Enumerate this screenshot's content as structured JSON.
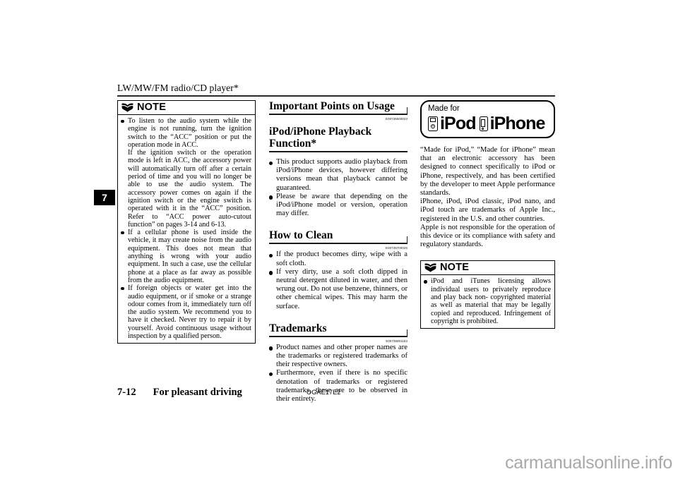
{
  "page": {
    "running_header": "LW/MW/FM radio/CD player*",
    "chapter_tab": "7",
    "folio": "7-12",
    "footer_title": "For pleasant driving",
    "doc_code": "OGAE17E2",
    "watermark": "carmanualsonline.info"
  },
  "left_column": {
    "note_box": {
      "title": "NOTE",
      "icon": "open-book-icon",
      "items": [
        "To listen to the audio system while the engine is not running, turn the ignition switch to the “ACC” position or put the operation mode in ACC.",
        "If a cellular phone is used inside the vehicle, it may create noise from the audio equipment. This does not mean that anything is wrong with your audio equipment. In such a case, use the cellular phone at a place as far away as possible from the audio equipment.",
        "If foreign objects or water get into the audio equipment, or if smoke or a strange odour comes from it, immediately turn off the audio system. We recommend you to have it checked. Never try to repair it by yourself. Avoid continuous usage without inspection by a qualified person."
      ],
      "continuation": "If the ignition switch or the operation mode is left in ACC, the accessory power will automatically turn off after a certain period of time and you will no longer be able to use the audio system. The accessory power comes on again if the ignition switch or the engine switch is operated with it in the “ACC” position. Refer to “ACC power auto-cutout function” on pages 3-14 and 6-13."
    }
  },
  "middle_column": {
    "sections": [
      {
        "title": "Important Points on Usage",
        "ref_code": "E00735500023",
        "items": []
      },
      {
        "title": "iPod/iPhone Playback Function*",
        "ref_code": "",
        "items": [
          "This product supports audio playback from iPod/iPhone devices, however differing versions mean that playback cannot be guaranteed.",
          "Please be aware that depending on the iPod/iPhone model or version, operation may differ."
        ]
      },
      {
        "title": "How to Clean",
        "ref_code": "E00735700025",
        "items": [
          "If the product becomes dirty, wipe with a soft cloth.",
          "If very dirty, use a soft cloth dipped in neutral detergent diluted in water, and then wrung out. Do not use benzene, thinners, or other chemical wipes. This may harm the surface."
        ]
      },
      {
        "title": "Trademarks",
        "ref_code": "E00735801153",
        "items": [
          "Product names and other proper names are the trademarks or registered trademarks of their respective owners.",
          "Furthermore, even if there is no specific denotation of trademarks or registered trademarks, these are to be observed in their entirety."
        ]
      }
    ]
  },
  "right_column": {
    "badge": {
      "made_for_label": "Made for",
      "ipod_label": "iPod",
      "iphone_label": "iPhone",
      "ipod_icon": "ipod-device-icon",
      "iphone_icon": "iphone-device-icon"
    },
    "paragraphs": [
      "“Made for iPod,” “Made for iPhone” mean that an electronic accessory has been designed to connect specifically to iPod or iPhone, respectively, and has been certified by the developer to meet Apple performance standards.",
      "iPhone, iPod, iPod classic, iPod nano, and iPod touch are trademarks of Apple Inc., registered in the U.S. and other countries.",
      "Apple is not responsible for the operation of this device or its compliance with safety and regulatory standards."
    ],
    "note_box": {
      "title": "NOTE",
      "icon": "open-book-icon",
      "items": [
        "iPod and iTunes licensing allows individual users to privately reproduce and play back non- copyrighted material as well as material that may be legally copied and reproduced. Infringement of copyright is prohibited."
      ]
    }
  }
}
